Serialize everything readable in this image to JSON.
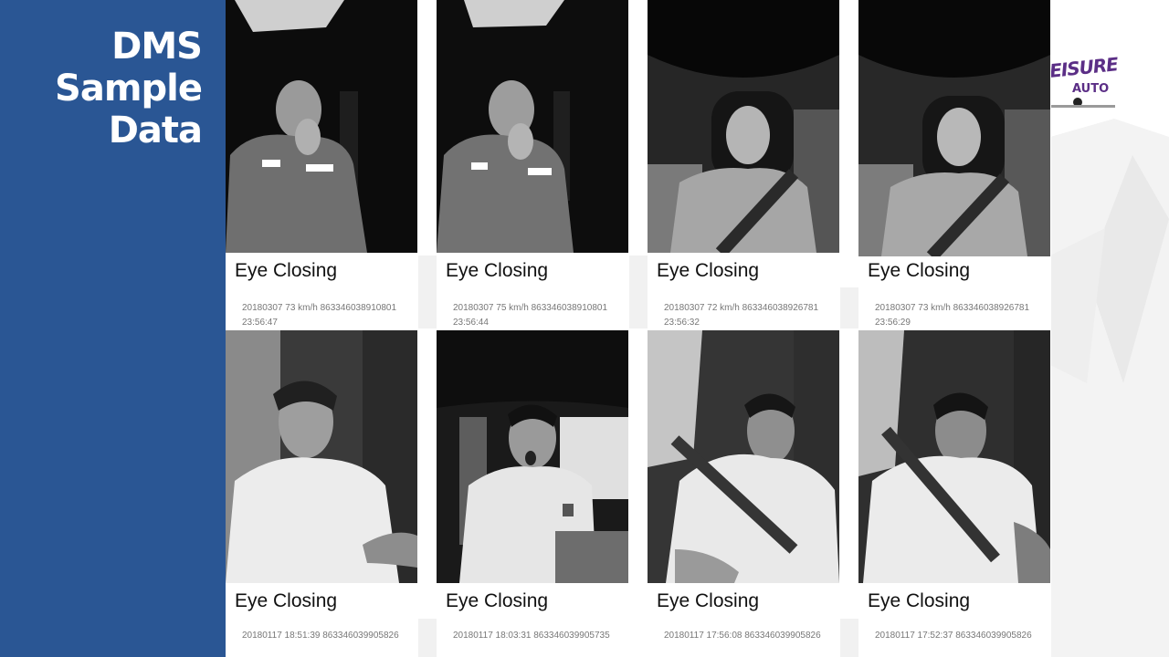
{
  "slide": {
    "title_lines": [
      "DMS",
      "Sample",
      "Data"
    ],
    "logo": {
      "text": "EISURE",
      "sub": "AUTO"
    }
  },
  "samples": [
    {
      "label": "Eye Closing",
      "meta": "20180307   73 km/h  863346038910801\n23:56:47"
    },
    {
      "label": "Eye Closing",
      "meta": "20180307   75 km/h  863346038910801\n23:56:44"
    },
    {
      "label": "Eye Closing",
      "meta": "20180307   72 km/h  863346038926781\n23:56:32"
    },
    {
      "label": "Eye Closing",
      "meta": "20180307   73 km/h  863346038926781\n23:56:29"
    },
    {
      "label": "Eye Closing",
      "meta": "20180117 18:51:39 863346039905826"
    },
    {
      "label": "Eye Closing",
      "meta": "20180117 18:03:31 863346039905735"
    },
    {
      "label": "Eye Closing",
      "meta": "20180117 17:56:08 863346039905826"
    },
    {
      "label": "Eye Closing",
      "meta": "20180117 17:52:37 863346039905826"
    }
  ]
}
